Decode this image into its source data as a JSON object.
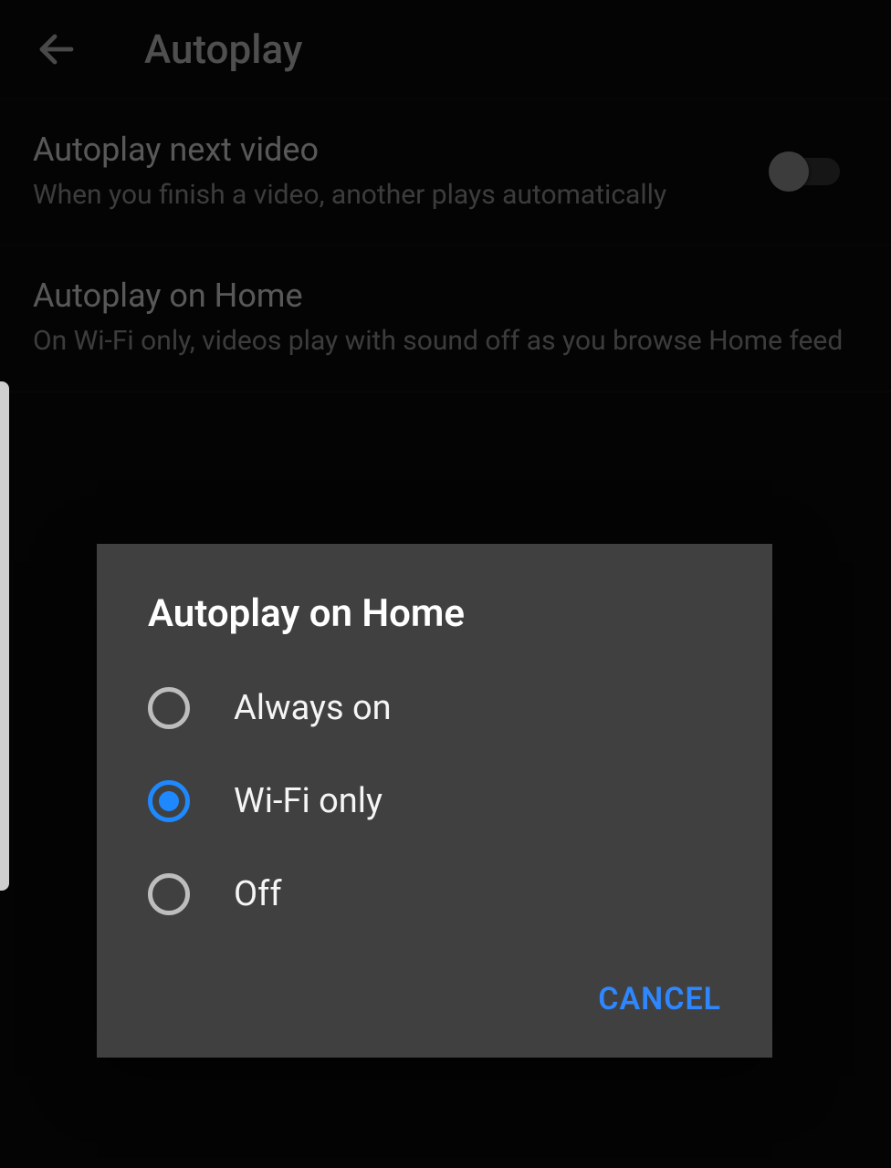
{
  "appbar": {
    "title": "Autoplay"
  },
  "settings": {
    "autoplay_next": {
      "title": "Autoplay next video",
      "subtitle": "When you finish a video, another plays automatically",
      "enabled": false
    },
    "autoplay_home": {
      "title": "Autoplay on Home",
      "subtitle": "On Wi-Fi only, videos play with sound off as you browse Home feed"
    }
  },
  "dialog": {
    "title": "Autoplay on Home",
    "options": [
      {
        "label": "Always on",
        "selected": false
      },
      {
        "label": "Wi-Fi only",
        "selected": true
      },
      {
        "label": "Off",
        "selected": false
      }
    ],
    "cancel": "CANCEL"
  },
  "colors": {
    "accent": "#1e88ff"
  }
}
